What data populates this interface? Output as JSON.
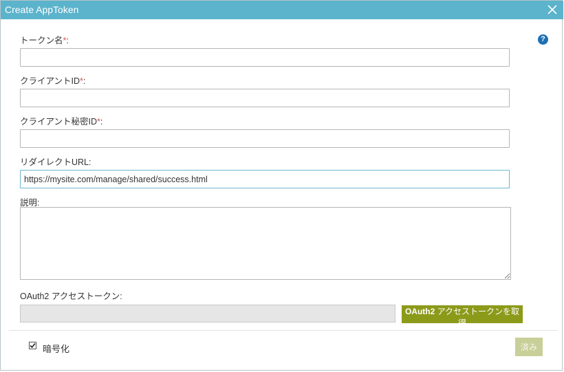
{
  "dialog": {
    "title": "Create AppToken",
    "close_icon": "close-icon",
    "help_icon": "help-icon",
    "help_glyph": "?"
  },
  "fields": {
    "token_name_label": "トークン名",
    "client_id_label": "クライアントID",
    "client_secret_label": "クライアント秘密ID",
    "redirect_url_label": "リダイレクトURL:",
    "redirect_url_value": "https://mysite.com/manage/shared/success.html",
    "description_label": "説明:",
    "oauth_token_label": "OAuth2 アクセストークン:",
    "required_mark": "*",
    "colon": ":"
  },
  "buttons": {
    "get_token_bold": "OAuth2",
    "get_token_rest": " アクセストークンを取得",
    "done": "済み"
  },
  "options": {
    "encrypt_label": "暗号化",
    "encrypt_checked": true
  },
  "colors": {
    "titlebar": "#5bb3cc",
    "help": "#1f6fb4",
    "get_token_button": "#8c9a1a",
    "done_button": "#c9cf99",
    "required": "#d9534f"
  }
}
